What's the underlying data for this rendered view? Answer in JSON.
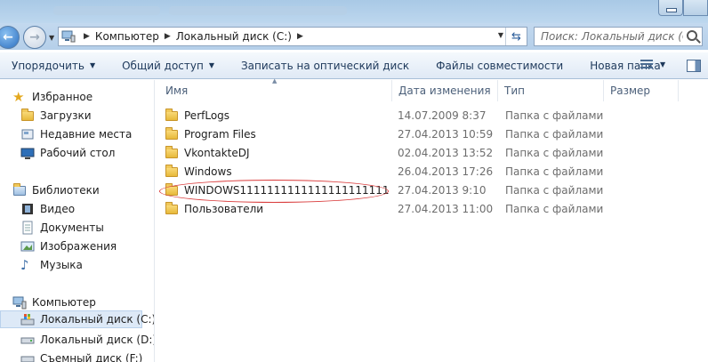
{
  "address": {
    "crumbs": [
      "Компьютер",
      "Локальный диск (C:)"
    ],
    "search_placeholder": "Поиск: Локальный диск (C:)"
  },
  "toolbar": {
    "organize": "Упорядочить",
    "share": "Общий доступ",
    "burn": "Записать на оптический диск",
    "compat": "Файлы совместимости",
    "new_folder": "Новая папка"
  },
  "nav": {
    "favorites": "Избранное",
    "downloads": "Загрузки",
    "recent": "Недавние места",
    "desktop": "Рабочий стол",
    "libraries": "Библиотеки",
    "video": "Видео",
    "documents": "Документы",
    "pictures": "Изображения",
    "music": "Музыка",
    "computer": "Компьютер",
    "disk_c": "Локальный диск (C:)",
    "disk_d": "Локальный диск (D:)",
    "removable": "Съемный диск (F:)"
  },
  "columns": {
    "name": "Имя",
    "date": "Дата изменения",
    "type": "Тип",
    "size": "Размер"
  },
  "files": [
    {
      "name": "PerfLogs",
      "date": "14.07.2009 8:37",
      "type": "Папка с файлами"
    },
    {
      "name": "Program Files",
      "date": "27.04.2013 10:59",
      "type": "Папка с файлами"
    },
    {
      "name": "VkontakteDJ",
      "date": "02.04.2013 13:52",
      "type": "Папка с файлами"
    },
    {
      "name": "Windows",
      "date": "26.04.2013 17:26",
      "type": "Папка с файлами"
    },
    {
      "name": "WINDOWS1111111111111111111111",
      "date": "27.04.2013 9:10",
      "type": "Папка с файлами"
    },
    {
      "name": "Пользователи",
      "date": "27.04.2013 11:00",
      "type": "Папка с файлами"
    }
  ],
  "colors": {
    "highlight_ring": "#d93b3b",
    "selection": "#dde9f7"
  }
}
